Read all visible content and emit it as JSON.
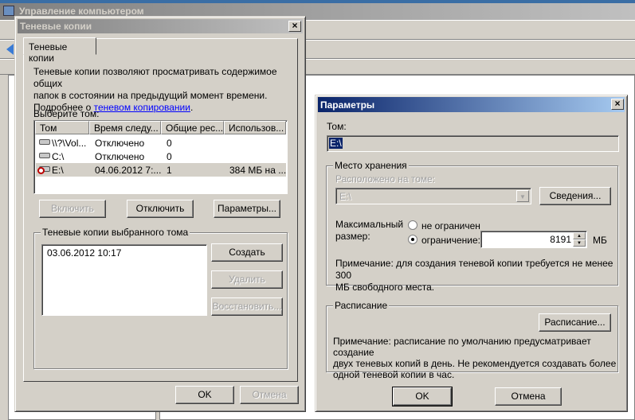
{
  "background_window": {
    "title": "Управление компьютером"
  },
  "shadow_dialog": {
    "title": "Теневые копии",
    "tab": "Теневые копии",
    "description_line1": "Теневые копии позволяют просматривать содержимое общих",
    "description_line2": "папок в состоянии на предыдущий момент времени.",
    "more_prefix": "Подробнее о ",
    "more_link": "теневом копировании",
    "more_suffix": ".",
    "select_volume_label": "Выберите том:",
    "columns": [
      "Том",
      "Время следу...",
      "Общие рес...",
      "Использов..."
    ],
    "rows": [
      {
        "volume": "\\\\?\\Vol...",
        "next_time": "Отключено",
        "shares": "0",
        "used": "",
        "icon": "drive-icon"
      },
      {
        "volume": "C:\\",
        "next_time": "Отключено",
        "shares": "0",
        "used": "",
        "icon": "drive-icon"
      },
      {
        "volume": "E:\\",
        "next_time": "04.06.2012 7:...",
        "shares": "1",
        "used": "384 МБ на ...",
        "icon": "scheduled-drive-icon",
        "selected": true
      }
    ],
    "enable_button": "Включить",
    "disable_button": "Отключить",
    "settings_button": "Параметры...",
    "copies_group": "Теневые копии выбранного тома",
    "copies": [
      "03.06.2012 10:17"
    ],
    "create_button": "Создать",
    "delete_button": "Удалить",
    "restore_button": "Восстановить...",
    "ok_button": "OK",
    "cancel_button": "Отмена"
  },
  "settings_dialog": {
    "title": "Параметры",
    "volume_label": "Том:",
    "volume_value": "E:\\",
    "storage_group": "Место хранения",
    "located_label": "Расположено на томе:",
    "located_value": "E:\\",
    "details_button": "Сведения...",
    "max_size_label1": "Максимальный",
    "max_size_label2": "размер:",
    "unlimited_label": "не ограничен",
    "limit_label": "ограничение:",
    "limit_value": "8191",
    "unit": "МБ",
    "selected_option": "limit",
    "storage_note1": "Примечание: для создания теневой копии требуется не менее 300",
    "storage_note2": "МБ свободного места.",
    "schedule_group": "Расписание",
    "schedule_button": "Расписание...",
    "schedule_note1": "Примечание: расписание по умолчанию предусматривает создание",
    "schedule_note2": "двух теневых копий в день. Не рекомендуется создавать более",
    "schedule_note3": "одной теневой копии в час.",
    "ok_button": "OK",
    "cancel_button": "Отмена"
  },
  "colors": {
    "active_title_start": "#0a246a",
    "active_title_end": "#a6caf0",
    "link": "#0000ff"
  }
}
